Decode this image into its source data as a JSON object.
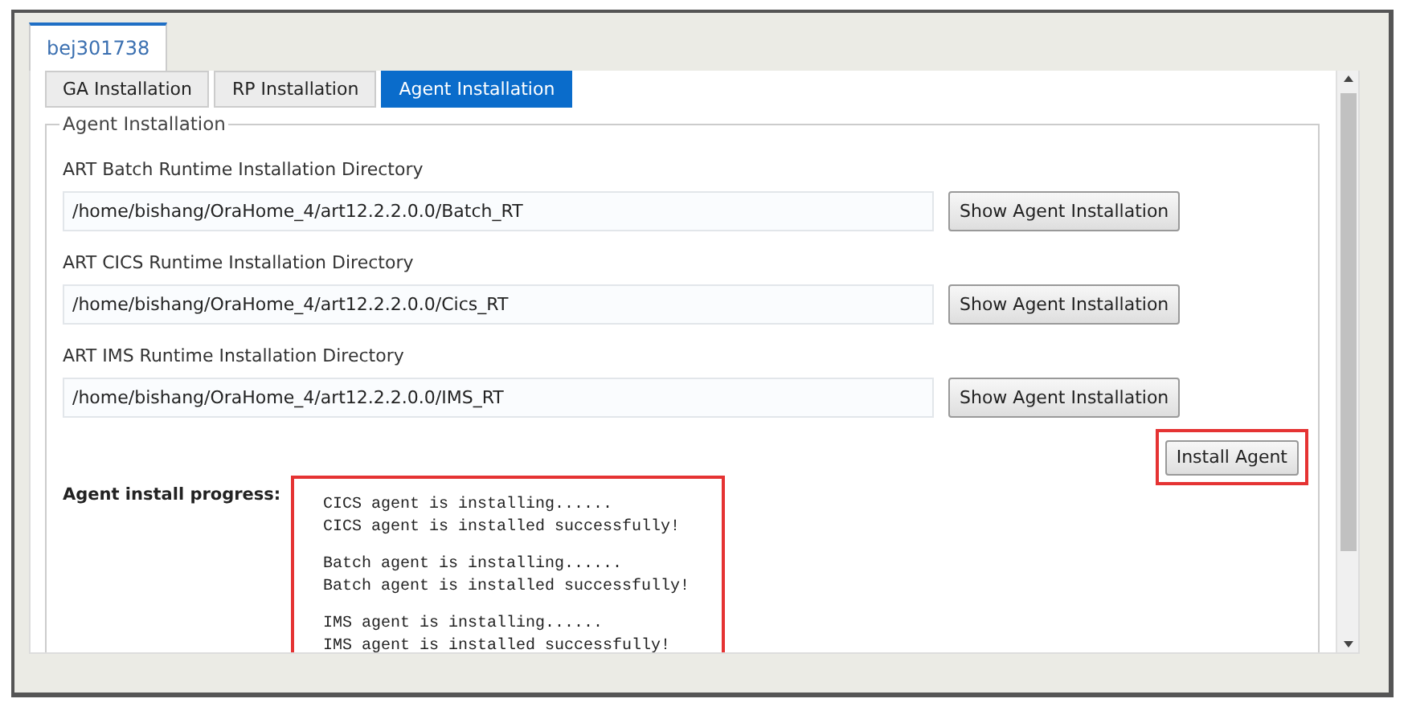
{
  "top_tabs": [
    {
      "label": "bej301738",
      "selected": true
    }
  ],
  "sub_tabs": [
    {
      "label": "GA Installation",
      "selected": false
    },
    {
      "label": "RP Installation",
      "selected": false
    },
    {
      "label": "Agent Installation",
      "selected": true
    }
  ],
  "fieldset": {
    "legend": "Agent Installation",
    "directories": [
      {
        "label": "ART Batch Runtime Installation Directory",
        "value": "/home/bishang/OraHome_4/art12.2.2.0.0/Batch_RT",
        "button": "Show Agent Installation"
      },
      {
        "label": "ART CICS Runtime Installation Directory",
        "value": "/home/bishang/OraHome_4/art12.2.2.0.0/Cics_RT",
        "button": "Show Agent Installation"
      },
      {
        "label": "ART IMS Runtime Installation Directory",
        "value": "/home/bishang/OraHome_4/art12.2.2.0.0/IMS_RT",
        "button": "Show Agent Installation"
      }
    ],
    "install_button": {
      "label": "Install Agent",
      "highlighted": true
    },
    "progress": {
      "label": "Agent install progress:",
      "highlighted": true,
      "groups": [
        [
          "CICS agent is installing......",
          "CICS agent is installed successfully!"
        ],
        [
          "Batch agent is installing......",
          "Batch agent is installed successfully!"
        ],
        [
          "IMS agent is installing......",
          "IMS agent is installed successfully!"
        ]
      ]
    }
  }
}
